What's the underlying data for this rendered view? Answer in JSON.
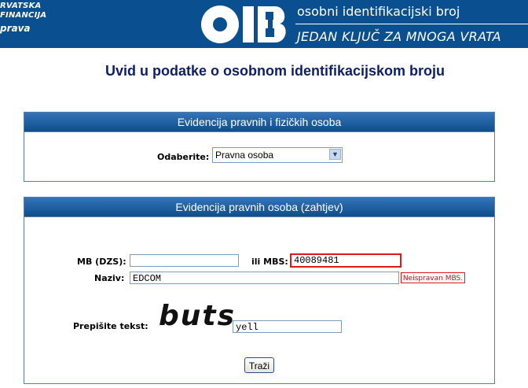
{
  "header": {
    "org_line1": "RVATSKA",
    "org_line2": "FINANCIJA",
    "org_line3": "prava",
    "logo_text": "OIB",
    "tagline_top": "osobni identifikacijski broj",
    "tagline_bottom": "JEDAN KLJUČ ZA MNOGA VRATA"
  },
  "page_title": "Uvid u podatke o osobnom identifikacijskom broju",
  "panel1": {
    "title": "Evidencija pravnih i fizičkih osoba",
    "select_label": "Odaberite:",
    "select_value": "Pravna osoba"
  },
  "panel2": {
    "title": "Evidencija pravnih osoba (zahtjev)",
    "mb_label": "MB (DZS):",
    "mb_value": "",
    "mbs_label": "ili MBS:",
    "mbs_value": "40089481",
    "naziv_label": "Naziv:",
    "naziv_value": "EDCOM",
    "error_text": "Neispravan MBS.",
    "captcha_label": "Prepišite tekst:",
    "captcha_image_text": "buts",
    "captcha_value": "yell",
    "submit_label": "Traži"
  },
  "colors": {
    "header_bg": "#0a4f8f",
    "panel_header": "#1d5fa3",
    "title_color": "#0d1f6b",
    "error_red": "#e01818"
  }
}
